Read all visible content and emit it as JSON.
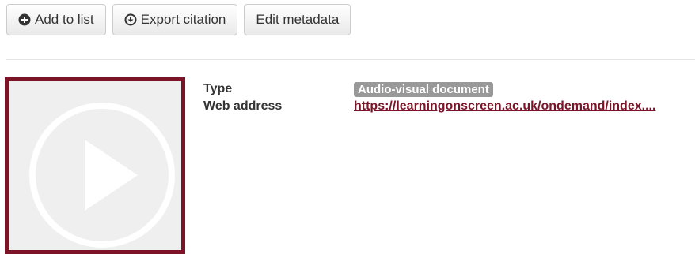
{
  "toolbar": {
    "add_to_list_label": "Add to list",
    "add_to_list_icon": "plus-circle-icon",
    "export_citation_label": "Export citation",
    "export_citation_icon": "arrow-down-circle-icon",
    "edit_metadata_label": "Edit metadata"
  },
  "record": {
    "thumbnail_icon": "play-icon",
    "thumbnail_border_color": "#7a1426",
    "fields": {
      "type_label": "Type",
      "type_value": "Audio-visual document",
      "web_address_label": "Web address",
      "web_address_value": "https://learningonscreen.ac.uk/ondemand/index...."
    }
  }
}
